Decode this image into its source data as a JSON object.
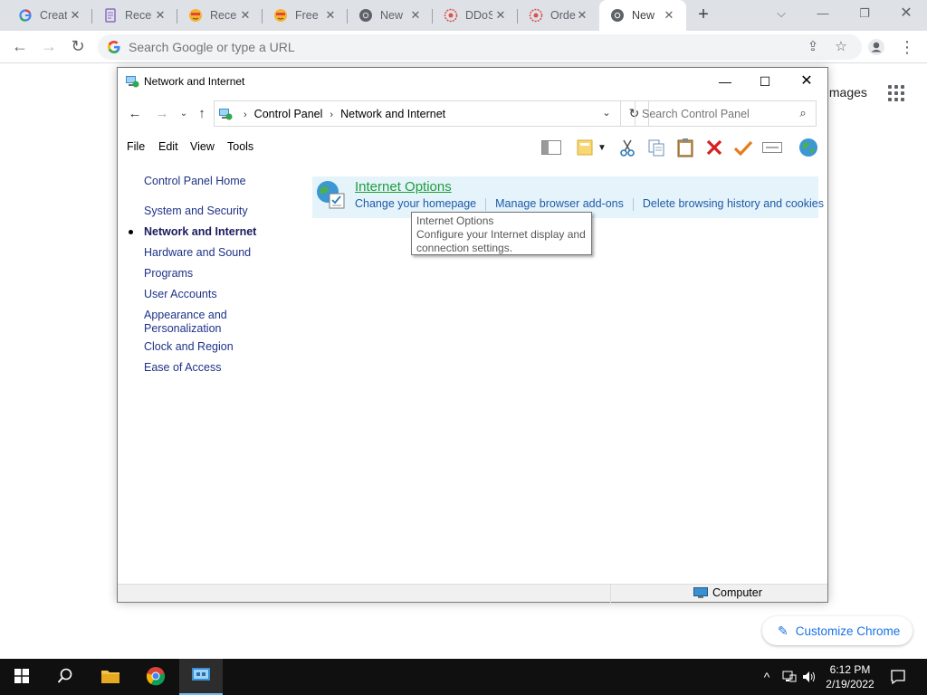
{
  "chrome": {
    "tabs": [
      {
        "title": "Creat",
        "icon": "google-g-icon",
        "active": false
      },
      {
        "title": "Recei",
        "icon": "doc-icon",
        "active": false
      },
      {
        "title": "Recei",
        "icon": "smiley-icon",
        "active": false
      },
      {
        "title": "Free I",
        "icon": "smiley-icon",
        "active": false
      },
      {
        "title": "New",
        "icon": "chrome-icon",
        "active": false
      },
      {
        "title": "DDoS",
        "icon": "flower-icon",
        "active": false
      },
      {
        "title": "Orde",
        "icon": "flower-icon",
        "active": false
      },
      {
        "title": "New",
        "icon": "chrome-icon",
        "active": true
      }
    ],
    "omnibox_placeholder": "Search Google or type a URL",
    "images_link": "Images",
    "customize_label": "Customize Chrome"
  },
  "control_panel": {
    "window_title": "Network and Internet",
    "breadcrumbs": [
      "Control Panel",
      "Network and Internet"
    ],
    "search_placeholder": "Search Control Panel",
    "menu": [
      "File",
      "Edit",
      "View",
      "Tools"
    ],
    "left_nav": {
      "home": "Control Panel Home",
      "items": [
        "System and Security",
        "Network and Internet",
        "Hardware and Sound",
        "Programs",
        "User Accounts",
        "Appearance and Personalization",
        "Clock and Region",
        "Ease of Access"
      ],
      "current_index": 1
    },
    "category": {
      "title": "Internet Options",
      "links": [
        "Change your homepage",
        "Manage browser add-ons",
        "Delete browsing history and cookies"
      ]
    },
    "tooltip": {
      "title": "Internet Options",
      "body": "Configure your Internet display and connection settings."
    },
    "status_bar": "Computer"
  },
  "taskbar": {
    "time": "6:12 PM",
    "date": "2/19/2022"
  },
  "colors": {
    "link_green": "#1e9e3b",
    "link_blue": "#1e5aa6",
    "chrome_blue": "#1a73e8",
    "taskbar": "#101010"
  }
}
